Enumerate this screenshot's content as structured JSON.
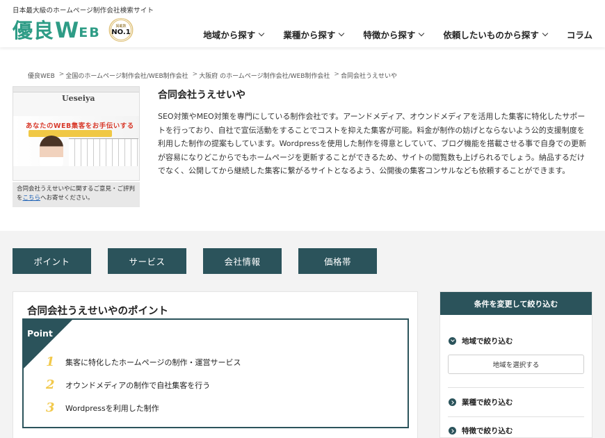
{
  "header": {
    "tagline": "日本最大級のホームページ制作会社検索サイト",
    "logo_jp": "優良",
    "logo_w": "W",
    "logo_eb": "EB",
    "badge_small": "掲載数",
    "badge_main": "NO.1",
    "nav": [
      {
        "label": "地域から探す"
      },
      {
        "label": "業種から探す"
      },
      {
        "label": "特徴から探す"
      },
      {
        "label": "依頼したいものから探す"
      },
      {
        "label": "コラム"
      }
    ]
  },
  "breadcrumb": [
    "優良WEB",
    "全国のホームページ制作会社/WEB制作会社",
    "大阪府 のホームページ制作会社/WEB制作会社",
    "合同会社うえせいや"
  ],
  "company": {
    "thumb_brand": "Ueseiya",
    "thumb_headline": "あなたのWEB集客をお手伝いする",
    "note_prefix": "合同会社うえせいやに関するご意見・ご評判を",
    "note_link": "こちら",
    "note_suffix": "へお寄せください。",
    "title": "合同会社うえせいや",
    "description": "SEO対策やMEO対策を専門にしている制作会社です。アーンドメディア、オウンドメディアを活用した集客に特化したサポートを行っており、自社で宣伝活動をすることでコストを抑えた集客が可能。料金が制作の妨げとならないよう公的支援制度を利用した制作の提案もしています。Wordpressを使用した制作を得意としていて、ブログ機能を搭載させる事で自身での更新が容易になりどこからでもホームページを更新することができるため、サイトの閲覧数も上げられるでしょう。納品するだけでなく、公開してから継続した集客に繋がるサイトとなるよう、公開後の集客コンサルなども依頼することができます。"
  },
  "tabs": [
    {
      "label": "ポイント"
    },
    {
      "label": "サービス"
    },
    {
      "label": "会社情報"
    },
    {
      "label": "価格帯"
    }
  ],
  "points": {
    "title": "合同会社うえせいやのポイント",
    "label": "Point",
    "items": [
      {
        "num": "1",
        "text": "集客に特化したホームページの制作・運営サービス"
      },
      {
        "num": "2",
        "text": "オウンドメディアの制作で自社集客を行う"
      },
      {
        "num": "3",
        "text": "Wordpressを利用した制作"
      }
    ]
  },
  "sidebar": {
    "title": "条件を変更して絞り込む",
    "region_label": "地域で絞り込む",
    "region_button": "地域を選択する",
    "industry_label": "業種で絞り込む",
    "feature_label": "特徴で絞り込む"
  },
  "colors": {
    "brand_green": "#2e9c86",
    "dark_teal": "#2b535b",
    "accent_yellow": "#f2c94c"
  }
}
